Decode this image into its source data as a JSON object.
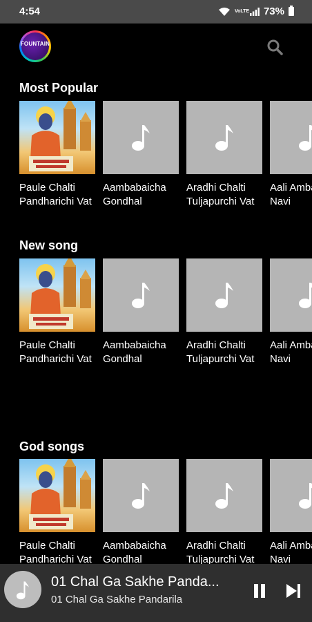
{
  "status": {
    "time": "4:54",
    "volte": "VoLTE",
    "battery": "73%"
  },
  "app": {
    "logo_text": "FOUNTAIN"
  },
  "sections": [
    {
      "title": "Most Popular",
      "items": [
        {
          "title": "Paule Chalti Pandharichi Vat",
          "art": "album-art"
        },
        {
          "title": "Aambabaicha Gondhal",
          "art": "music-note-icon"
        },
        {
          "title": "Aradhi Chalti Tuljapurchi Vat",
          "art": "music-note-icon"
        },
        {
          "title": "Aali Ambabai Navi",
          "art": "music-note-icon"
        }
      ]
    },
    {
      "title": "New song",
      "items": [
        {
          "title": "Paule Chalti Pandharichi Vat",
          "art": "album-art"
        },
        {
          "title": "Aambabaicha Gondhal",
          "art": "music-note-icon"
        },
        {
          "title": "Aradhi Chalti Tuljapurchi Vat",
          "art": "music-note-icon"
        },
        {
          "title": "Aali Ambabai Navi",
          "art": "music-note-icon"
        }
      ]
    },
    {
      "title": "God songs",
      "items": [
        {
          "title": "Paule Chalti Pandharichi Vat",
          "art": "album-art"
        },
        {
          "title": "Aambabaicha Gondhal",
          "art": "music-note-icon"
        },
        {
          "title": "Aradhi Chalti Tuljapurchi Vat",
          "art": "music-note-icon"
        },
        {
          "title": "Aali Ambabai Navi",
          "art": "music-note-icon"
        }
      ]
    }
  ],
  "player": {
    "title": "01 Chal Ga Sakhe Panda...",
    "subtitle": "01 Chal Ga Sakhe Pandarila"
  },
  "colors": {
    "background": "#000000",
    "placeholder": "#b5b5b5",
    "player_bg": "#2f2f2f",
    "status_bg": "#4a4a4a"
  }
}
